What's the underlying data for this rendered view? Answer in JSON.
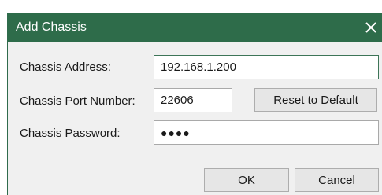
{
  "dialog": {
    "title": "Add Chassis",
    "close_icon": "close-icon"
  },
  "form": {
    "address_label": "Chassis Address:",
    "address_value": "192.168.1.200",
    "port_label": "Chassis Port Number:",
    "port_value": "22606",
    "reset_label": "Reset to Default",
    "password_label": "Chassis Password:",
    "password_value": "●●●●"
  },
  "buttons": {
    "ok_label": "OK",
    "cancel_label": "Cancel"
  },
  "colors": {
    "titlebar": "#2e6c4a",
    "dialog_background": "#f0f0f0",
    "focused_border": "#3e7558"
  }
}
